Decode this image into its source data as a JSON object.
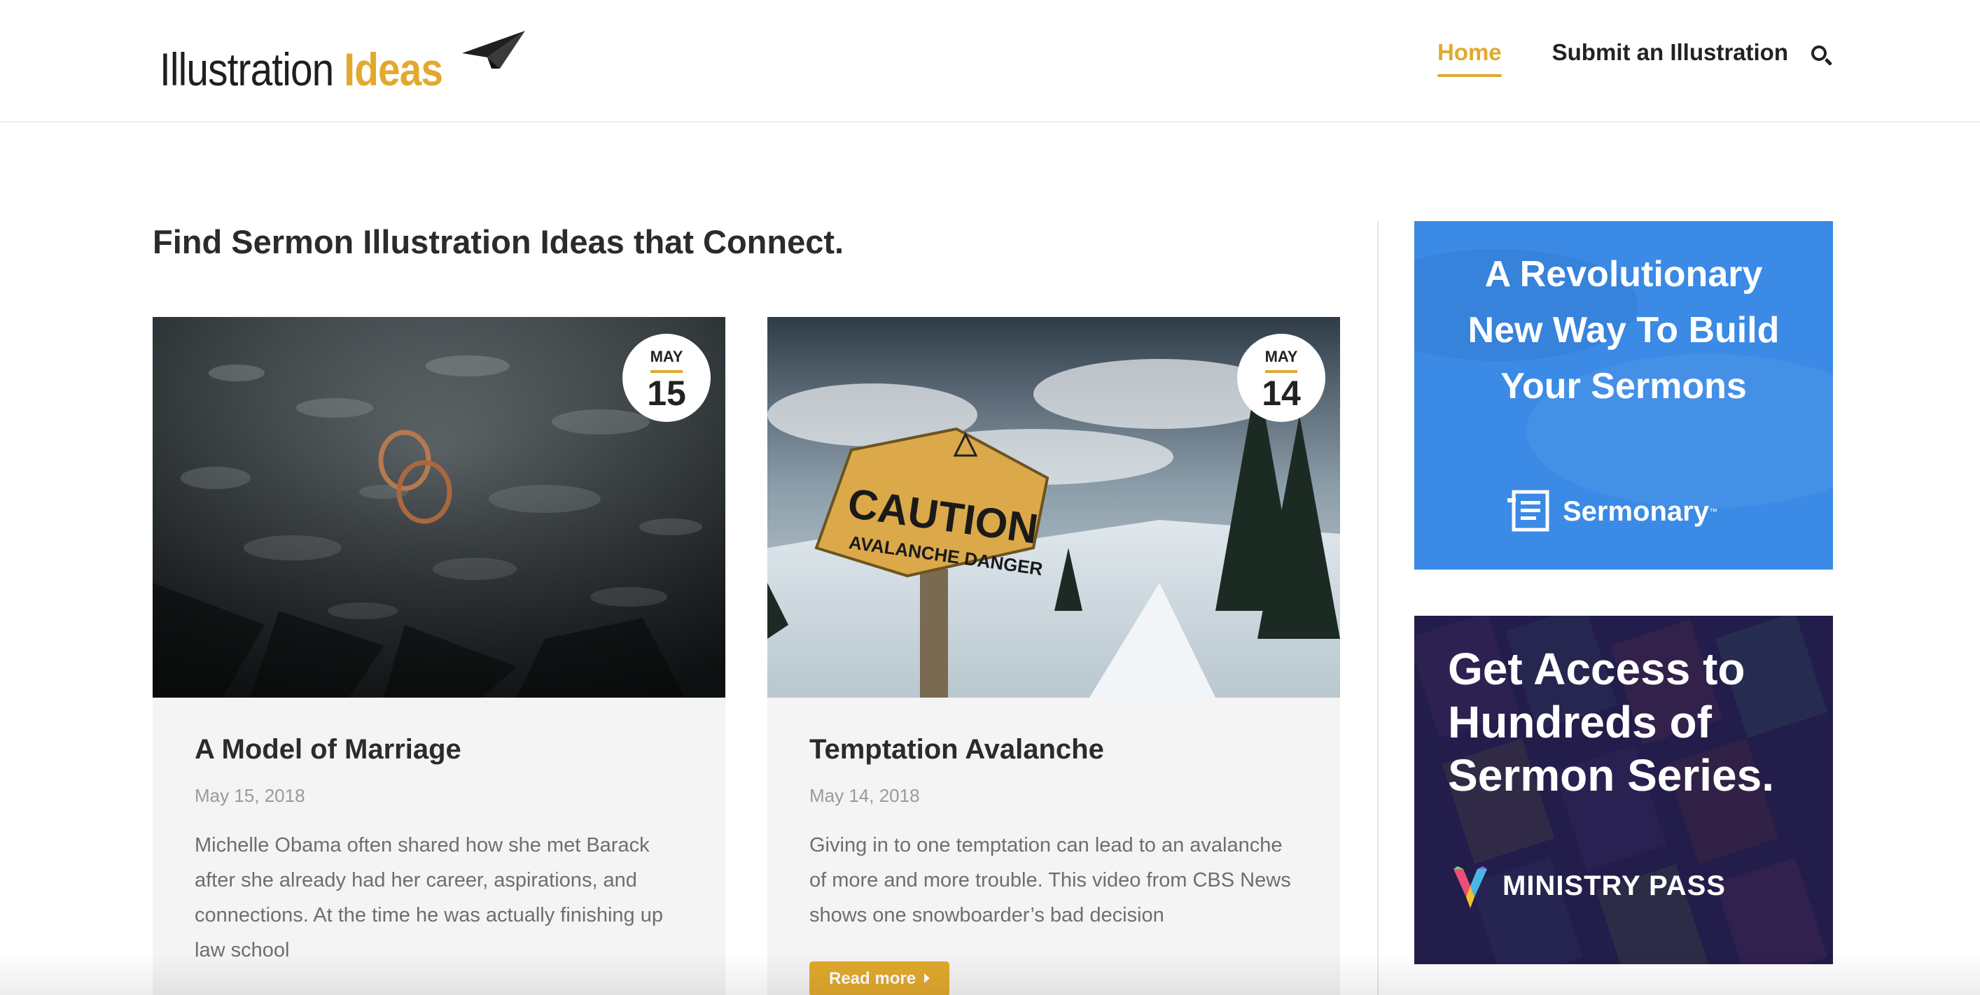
{
  "header": {
    "logo": {
      "word1": "Illustration",
      "word2": "Ideas"
    },
    "nav": [
      {
        "label": "Home",
        "active": true
      },
      {
        "label": "Submit an Illustration",
        "active": false
      }
    ]
  },
  "main": {
    "heading": "Find Sermon Illustration Ideas that Connect.",
    "posts": [
      {
        "badge_month": "MAY",
        "badge_day": "15",
        "title": "A Model of Marriage",
        "date": "May 15, 2018",
        "excerpt": "Michelle Obama often shared how she met Barack after she already had her career, aspirations, and connections. At the time he was actually finishing up law school",
        "image": "wedding-rings-on-wet-glass"
      },
      {
        "badge_month": "MAY",
        "badge_day": "14",
        "title": "Temptation Avalanche",
        "date": "May 14, 2018",
        "excerpt": "Giving in to one temptation can lead to an avalanche of more and more trouble. This video from CBS News shows one snowboarder’s bad decision",
        "image": "caution-avalanche-sign",
        "sign_line1": "CAUTION",
        "sign_line2": "AVALANCHE DANGER",
        "read_more": "Read more"
      }
    ]
  },
  "sidebar": {
    "ad1": {
      "line1": "A Revolutionary",
      "line2": "New Way To Build",
      "line3": "Your Sermons",
      "brand": "Sermonary",
      "tm": "™"
    },
    "ad2": {
      "line1": "Get Access to",
      "line2": "Hundreds of",
      "line3": "Sermon Series.",
      "brand": "MINISTRY PASS"
    }
  },
  "colors": {
    "accent": "#e2a92e",
    "ad1_bg": "#3a8ae6",
    "ad2_bg": "#221d4a",
    "card_bg": "#f4f4f4"
  }
}
